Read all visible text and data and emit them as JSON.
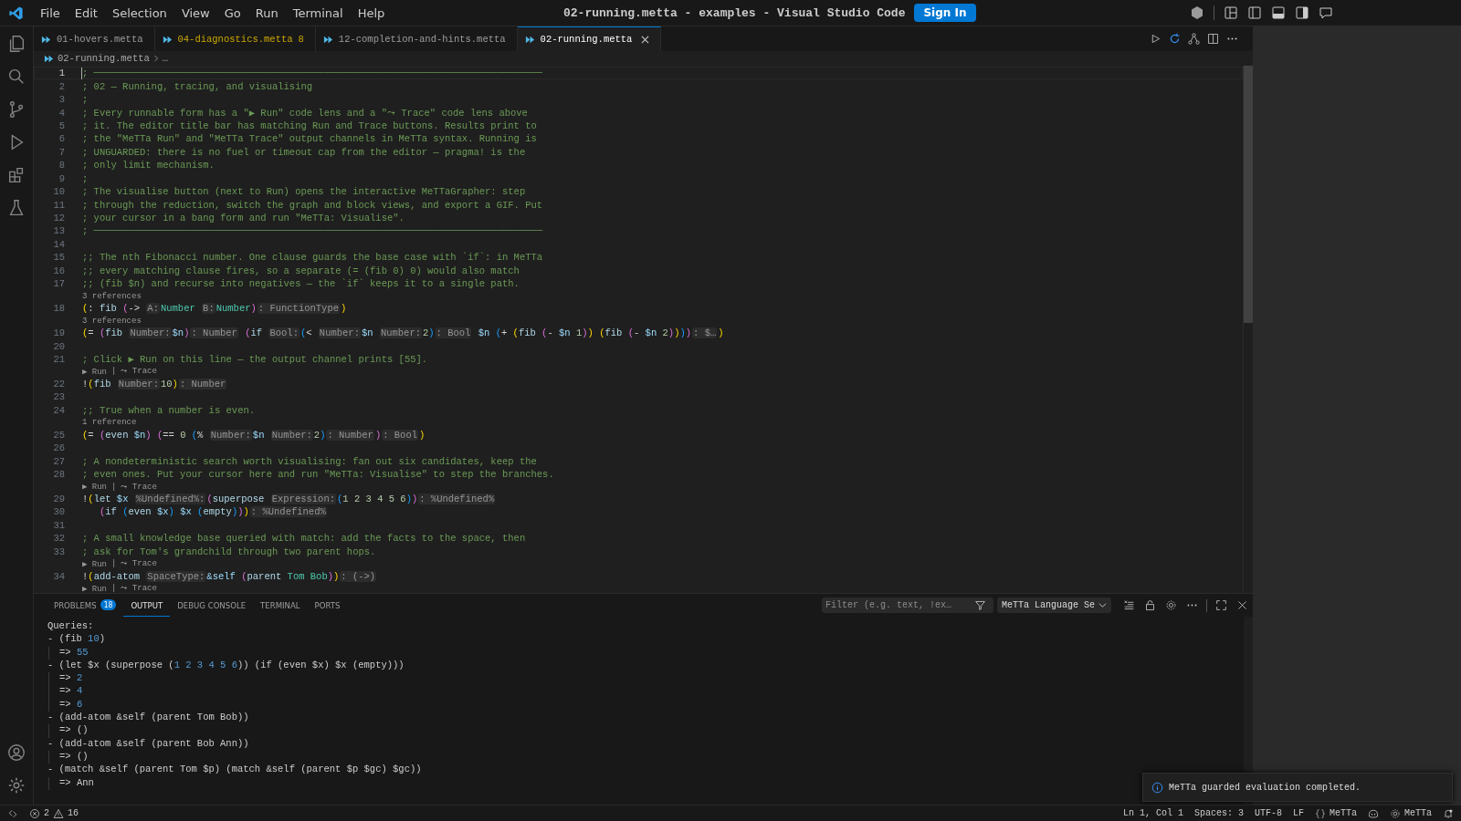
{
  "menu": [
    "File",
    "Edit",
    "Selection",
    "View",
    "Go",
    "Run",
    "Terminal",
    "Help"
  ],
  "window": {
    "title": "02-running.metta - examples - Visual Studio Code",
    "sign_in": "Sign In"
  },
  "tabs": [
    {
      "label": "01-hovers.metta",
      "selected": false,
      "warning": false
    },
    {
      "label": "04-diagnostics.metta",
      "selected": false,
      "warning": true,
      "count": "8"
    },
    {
      "label": "12-completion-and-hints.metta",
      "selected": false,
      "warning": false
    },
    {
      "label": "02-running.metta",
      "selected": true,
      "warning": false
    }
  ],
  "breadcrumb": [
    "02-running.metta",
    "…"
  ],
  "editor": {
    "lines": [
      {
        "kind": "code",
        "number": "1",
        "current": true,
        "tokens": [
          {
            "kind": "comment",
            "text": "; ──────────────────────────────────────────────────────────────────────────────"
          }
        ]
      },
      {
        "kind": "code",
        "number": "2",
        "tokens": [
          {
            "kind": "comment",
            "text": "; 02 — Running, tracing, and visualising"
          }
        ]
      },
      {
        "kind": "code",
        "number": "3",
        "tokens": [
          {
            "kind": "comment",
            "text": ";"
          }
        ]
      },
      {
        "kind": "code",
        "number": "4",
        "tokens": [
          {
            "kind": "comment",
            "text": "; Every runnable form has a \"▶ Run\" code lens and a \"⤳ Trace\" code lens above"
          }
        ]
      },
      {
        "kind": "code",
        "number": "5",
        "tokens": [
          {
            "kind": "comment",
            "text": "; it. The editor title bar has matching Run and Trace buttons. Results print to"
          }
        ]
      },
      {
        "kind": "code",
        "number": "6",
        "tokens": [
          {
            "kind": "comment",
            "text": "; the \"MeTTa Run\" and \"MeTTa Trace\" output channels in MeTTa syntax. Running is"
          }
        ]
      },
      {
        "kind": "code",
        "number": "7",
        "tokens": [
          {
            "kind": "comment",
            "text": "; UNGUARDED: there is no fuel or timeout cap from the editor — pragma! is the"
          }
        ]
      },
      {
        "kind": "code",
        "number": "8",
        "tokens": [
          {
            "kind": "comment",
            "text": "; only limit mechanism."
          }
        ]
      },
      {
        "kind": "code",
        "number": "9",
        "tokens": [
          {
            "kind": "comment",
            "text": ";"
          }
        ]
      },
      {
        "kind": "code",
        "number": "10",
        "tokens": [
          {
            "kind": "comment",
            "text": "; The visualise button (next to Run) opens the interactive MeTTaGrapher: step"
          }
        ]
      },
      {
        "kind": "code",
        "number": "11",
        "tokens": [
          {
            "kind": "comment",
            "text": "; through the reduction, switch the graph and block views, and export a GIF. Put"
          }
        ]
      },
      {
        "kind": "code",
        "number": "12",
        "tokens": [
          {
            "kind": "comment",
            "text": "; your cursor in a bang form and run \"MeTTa: Visualise\"."
          }
        ]
      },
      {
        "kind": "code",
        "number": "13",
        "tokens": [
          {
            "kind": "comment",
            "text": "; ──────────────────────────────────────────────────────────────────────────────"
          }
        ]
      },
      {
        "kind": "code",
        "number": "14"
      },
      {
        "kind": "code",
        "number": "15",
        "tokens": [
          {
            "kind": "comment",
            "text": ";; The nth Fibonacci number. One clause guards the base case with `if`: in MeTTa"
          }
        ]
      },
      {
        "kind": "code",
        "number": "16",
        "tokens": [
          {
            "kind": "comment",
            "text": ";; every matching clause fires, so a separate (= (fib 0) 0) would also match"
          }
        ]
      },
      {
        "kind": "code",
        "number": "17",
        "tokens": [
          {
            "kind": "comment",
            "text": ";; (fib $n) and recurse into negatives — the `if` keeps it to a single path."
          }
        ]
      },
      {
        "kind": "lens",
        "links": [
          "3 references"
        ]
      },
      {
        "kind": "code",
        "number": "18",
        "tokens": [
          {
            "kind": "paren1",
            "text": "("
          },
          {
            "kind": "plain",
            "text": ": "
          },
          {
            "kind": "fn",
            "text": "fib "
          },
          {
            "kind": "paren2",
            "text": "("
          },
          {
            "kind": "plain",
            "text": "-> "
          },
          {
            "kind": "hint",
            "text": "A:"
          },
          {
            "kind": "type",
            "text": "Number "
          },
          {
            "kind": "hint",
            "text": "B:"
          },
          {
            "kind": "type",
            "text": "Number"
          },
          {
            "kind": "paren2",
            "text": ")"
          },
          {
            "kind": "hint",
            "text": ": FunctionType"
          },
          {
            "kind": "paren1",
            "text": ")"
          }
        ]
      },
      {
        "kind": "lens",
        "links": [
          "3 references"
        ]
      },
      {
        "kind": "code",
        "number": "19",
        "tokens": [
          {
            "kind": "paren1",
            "text": "("
          },
          {
            "kind": "plain",
            "text": "= "
          },
          {
            "kind": "paren2",
            "text": "("
          },
          {
            "kind": "fn",
            "text": "fib "
          },
          {
            "kind": "hint",
            "text": "Number:"
          },
          {
            "kind": "var",
            "text": "$n"
          },
          {
            "kind": "paren2",
            "text": ")"
          },
          {
            "kind": "hint",
            "text": ": Number"
          },
          {
            "kind": "paren2",
            "text": " ("
          },
          {
            "kind": "fn",
            "text": "if "
          },
          {
            "kind": "hint",
            "text": "Bool:"
          },
          {
            "kind": "paren3",
            "text": "("
          },
          {
            "kind": "plain",
            "text": "< "
          },
          {
            "kind": "hint",
            "text": "Number:"
          },
          {
            "kind": "var",
            "text": "$n "
          },
          {
            "kind": "hint",
            "text": "Number:"
          },
          {
            "kind": "num",
            "text": "2"
          },
          {
            "kind": "paren3",
            "text": ")"
          },
          {
            "kind": "hint",
            "text": ": Bool"
          },
          {
            "kind": "var",
            "text": " $n "
          },
          {
            "kind": "paren3",
            "text": "("
          },
          {
            "kind": "plain",
            "text": "+ "
          },
          {
            "kind": "paren1",
            "text": "("
          },
          {
            "kind": "fn",
            "text": "fib "
          },
          {
            "kind": "paren2",
            "text": "("
          },
          {
            "kind": "plain",
            "text": "- "
          },
          {
            "kind": "var",
            "text": "$n "
          },
          {
            "kind": "num",
            "text": "1"
          },
          {
            "kind": "paren2",
            "text": ")"
          },
          {
            "kind": "paren1",
            "text": ")"
          },
          {
            "kind": "paren1",
            "text": " ("
          },
          {
            "kind": "fn",
            "text": "fib "
          },
          {
            "kind": "paren2",
            "text": "("
          },
          {
            "kind": "plain",
            "text": "- "
          },
          {
            "kind": "var",
            "text": "$n "
          },
          {
            "kind": "num",
            "text": "2"
          },
          {
            "kind": "paren2",
            "text": ")"
          },
          {
            "kind": "paren1",
            "text": ")"
          },
          {
            "kind": "paren3",
            "text": ")"
          },
          {
            "kind": "paren2",
            "text": ")"
          },
          {
            "kind": "hint",
            "text": ": $…"
          },
          {
            "kind": "paren1",
            "text": ")"
          }
        ]
      },
      {
        "kind": "code",
        "number": "20"
      },
      {
        "kind": "code",
        "number": "21",
        "tokens": [
          {
            "kind": "comment",
            "text": "; Click ▶ Run on this line — the output channel prints [55]."
          }
        ]
      },
      {
        "kind": "lens",
        "links": [
          "▶ Run",
          "⤳ Trace"
        ],
        "separator": "|"
      },
      {
        "kind": "code",
        "number": "22",
        "tokens": [
          {
            "kind": "plain",
            "text": "!"
          },
          {
            "kind": "paren1",
            "text": "("
          },
          {
            "kind": "fn",
            "text": "fib "
          },
          {
            "kind": "hint",
            "text": "Number:"
          },
          {
            "kind": "num",
            "text": "10"
          },
          {
            "kind": "paren1",
            "text": ")"
          },
          {
            "kind": "hint",
            "text": ": Number"
          }
        ]
      },
      {
        "kind": "code",
        "number": "23"
      },
      {
        "kind": "code",
        "number": "24",
        "tokens": [
          {
            "kind": "comment",
            "text": ";; True when a number is even."
          }
        ]
      },
      {
        "kind": "lens",
        "links": [
          "1 reference"
        ]
      },
      {
        "kind": "code",
        "number": "25",
        "tokens": [
          {
            "kind": "paren1",
            "text": "("
          },
          {
            "kind": "plain",
            "text": "= "
          },
          {
            "kind": "paren2",
            "text": "("
          },
          {
            "kind": "fn",
            "text": "even "
          },
          {
            "kind": "var",
            "text": "$n"
          },
          {
            "kind": "paren2",
            "text": ")"
          },
          {
            "kind": "paren2",
            "text": " ("
          },
          {
            "kind": "plain",
            "text": "== "
          },
          {
            "kind": "num",
            "text": "0 "
          },
          {
            "kind": "paren3",
            "text": "("
          },
          {
            "kind": "plain",
            "text": "% "
          },
          {
            "kind": "hint",
            "text": "Number:"
          },
          {
            "kind": "var",
            "text": "$n "
          },
          {
            "kind": "hint",
            "text": "Number:"
          },
          {
            "kind": "num",
            "text": "2"
          },
          {
            "kind": "paren3",
            "text": ")"
          },
          {
            "kind": "hint",
            "text": ": Number"
          },
          {
            "kind": "paren2",
            "text": ")"
          },
          {
            "kind": "hint",
            "text": ": Bool"
          },
          {
            "kind": "paren1",
            "text": ")"
          }
        ]
      },
      {
        "kind": "code",
        "number": "26"
      },
      {
        "kind": "code",
        "number": "27",
        "tokens": [
          {
            "kind": "comment",
            "text": "; A nondeterministic search worth visualising: fan out six candidates, keep the"
          }
        ]
      },
      {
        "kind": "code",
        "number": "28",
        "tokens": [
          {
            "kind": "comment",
            "text": "; even ones. Put your cursor here and run \"MeTTa: Visualise\" to step the branches."
          }
        ]
      },
      {
        "kind": "lens",
        "links": [
          "▶ Run",
          "⤳ Trace"
        ],
        "separator": "|"
      },
      {
        "kind": "code",
        "number": "29",
        "tokens": [
          {
            "kind": "plain",
            "text": "!"
          },
          {
            "kind": "paren1",
            "text": "("
          },
          {
            "kind": "fn",
            "text": "let "
          },
          {
            "kind": "var",
            "text": "$x "
          },
          {
            "kind": "hint",
            "text": "%Undefined%:"
          },
          {
            "kind": "paren2",
            "text": "("
          },
          {
            "kind": "fn",
            "text": "superpose "
          },
          {
            "kind": "hint",
            "text": "Expression:"
          },
          {
            "kind": "paren3",
            "text": "("
          },
          {
            "kind": "num",
            "text": "1 2 3 4 5 6"
          },
          {
            "kind": "paren3",
            "text": ")"
          },
          {
            "kind": "paren2",
            "text": ")"
          },
          {
            "kind": "hint",
            "text": ": %Undefined%"
          }
        ]
      },
      {
        "kind": "code",
        "number": "30",
        "tokens": [
          {
            "kind": "paren2",
            "text": "   ("
          },
          {
            "kind": "fn",
            "text": "if "
          },
          {
            "kind": "paren3",
            "text": "("
          },
          {
            "kind": "fn",
            "text": "even "
          },
          {
            "kind": "var",
            "text": "$x"
          },
          {
            "kind": "paren3",
            "text": ")"
          },
          {
            "kind": "var",
            "text": " $x "
          },
          {
            "kind": "paren3",
            "text": "("
          },
          {
            "kind": "fn",
            "text": "empty"
          },
          {
            "kind": "paren3",
            "text": ")"
          },
          {
            "kind": "paren2",
            "text": ")"
          },
          {
            "kind": "paren1",
            "text": ")"
          },
          {
            "kind": "hint",
            "text": ": %Undefined%"
          }
        ]
      },
      {
        "kind": "code",
        "number": "31"
      },
      {
        "kind": "code",
        "number": "32",
        "tokens": [
          {
            "kind": "comment",
            "text": "; A small knowledge base queried with match: add the facts to the space, then"
          }
        ]
      },
      {
        "kind": "code",
        "number": "33",
        "tokens": [
          {
            "kind": "comment",
            "text": "; ask for Tom's grandchild through two parent hops."
          }
        ]
      },
      {
        "kind": "lens",
        "links": [
          "▶ Run",
          "⤳ Trace"
        ],
        "separator": "|"
      },
      {
        "kind": "code",
        "number": "34",
        "tokens": [
          {
            "kind": "plain",
            "text": "!"
          },
          {
            "kind": "paren1",
            "text": "("
          },
          {
            "kind": "fn",
            "text": "add-atom "
          },
          {
            "kind": "hint",
            "text": "SpaceType:"
          },
          {
            "kind": "var",
            "text": "&self "
          },
          {
            "kind": "paren2",
            "text": "("
          },
          {
            "kind": "fn",
            "text": "parent "
          },
          {
            "kind": "type",
            "text": "Tom Bob"
          },
          {
            "kind": "paren2",
            "text": ")"
          },
          {
            "kind": "paren1",
            "text": ")"
          },
          {
            "kind": "hint",
            "text": ": (->)"
          }
        ]
      },
      {
        "kind": "lens",
        "links": [
          "▶ Run",
          "⤳ Trace"
        ],
        "separator": "|"
      }
    ]
  },
  "panel": {
    "tabs": [
      {
        "label": "PROBLEMS",
        "badge": "18",
        "selected": false
      },
      {
        "label": "OUTPUT",
        "selected": true
      },
      {
        "label": "DEBUG CONSOLE",
        "selected": false
      },
      {
        "label": "TERMINAL",
        "selected": false
      },
      {
        "label": "PORTS",
        "selected": false
      }
    ],
    "filter": {
      "placeholder": "Filter (e.g. text, !ex…"
    },
    "channel": "MeTTa Language Se",
    "output": {
      "header": "Queries:",
      "queries": [
        {
          "query": [
            {
              "kind": "plain",
              "text": "- (fib "
            },
            {
              "kind": "num",
              "text": "10"
            },
            {
              "kind": "plain",
              "text": ")"
            }
          ],
          "results": [
            [
              {
                "kind": "plain",
                "text": "=> "
              },
              {
                "kind": "num",
                "text": "55"
              }
            ]
          ]
        },
        {
          "query": [
            {
              "kind": "plain",
              "text": "- (let $x (superpose ("
            },
            {
              "kind": "num",
              "text": "1 2 3 4 5 6"
            },
            {
              "kind": "plain",
              "text": ")) (if (even $x) $x (empty)))"
            }
          ],
          "results": [
            [
              {
                "kind": "plain",
                "text": "=> "
              },
              {
                "kind": "num",
                "text": "2"
              }
            ],
            [
              {
                "kind": "plain",
                "text": "=> "
              },
              {
                "kind": "num",
                "text": "4"
              }
            ],
            [
              {
                "kind": "plain",
                "text": "=> "
              },
              {
                "kind": "num",
                "text": "6"
              }
            ]
          ]
        },
        {
          "query": [
            {
              "kind": "plain",
              "text": "- (add-atom &self (parent Tom Bob))"
            }
          ],
          "results": [
            [
              {
                "kind": "plain",
                "text": "=> ()"
              }
            ]
          ]
        },
        {
          "query": [
            {
              "kind": "plain",
              "text": "- (add-atom &self (parent Bob Ann))"
            }
          ],
          "results": [
            [
              {
                "kind": "plain",
                "text": "=> ()"
              }
            ]
          ]
        },
        {
          "query": [
            {
              "kind": "plain",
              "text": "- (match &self (parent Tom $p) (match &self (parent $p $gc) $gc))"
            }
          ],
          "results": [
            [
              {
                "kind": "plain",
                "text": "=> Ann"
              }
            ]
          ]
        }
      ]
    }
  },
  "notification": "MeTTa guarded evaluation completed.",
  "status_bar": {
    "errors": "2",
    "warnings": "16",
    "position": "Ln 1, Col 1",
    "spaces": "Spaces: 3",
    "encoding": "UTF-8",
    "eol": "LF",
    "language": "MeTTa",
    "server": "MeTTa"
  }
}
